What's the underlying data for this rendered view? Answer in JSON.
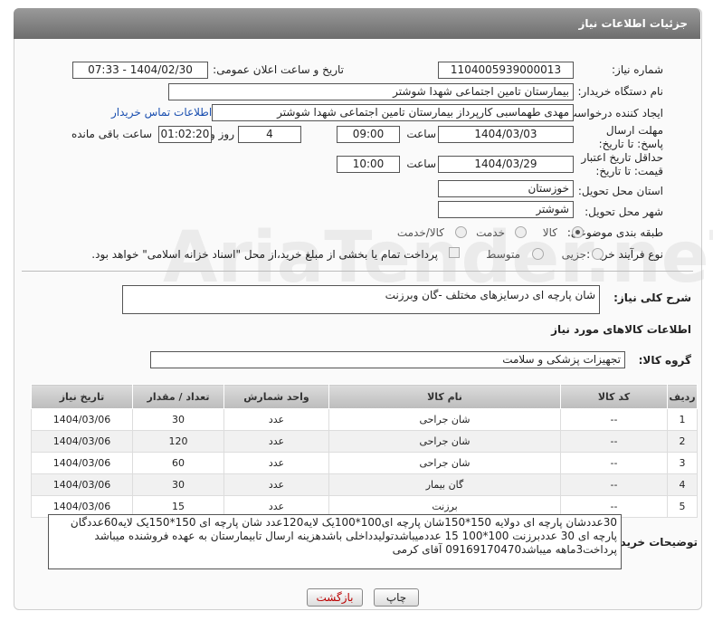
{
  "title": "جزئیات اطلاعات نیاز",
  "fields": {
    "need_number_label": "شماره نیاز:",
    "need_number": "1104005939000013",
    "announce_label": "تاریخ و ساعت اعلان عمومی:",
    "announce_value": "1404/02/30 - 07:33",
    "buyer_label": "نام دستگاه خریدار:",
    "buyer_value": "بیمارستان تامین اجتماعی شهدا شوشتر",
    "creator_label": "ایجاد کننده درخواست:",
    "creator_value": "مهدی طهماسبی کارپرداز بیمارستان تامین اجتماعی شهدا شوشتر",
    "contact_link": "اطلاعات تماس خریدار",
    "deadline_label": "مهلت ارسال پاسخ: تا تاریخ:",
    "deadline_date": "1404/03/03",
    "time_label": "ساعت",
    "deadline_time": "09:00",
    "days_value": "4",
    "days_label": "روز و",
    "remaining_value": "01:02:20",
    "remaining_label": "ساعت باقی مانده",
    "min_validity_label": "حداقل تاریخ اعتبار قیمت: تا تاریخ:",
    "validity_date": "1404/03/29",
    "validity_time": "10:00",
    "province_label": "استان محل تحویل:",
    "province_value": "خوزستان",
    "city_label": "شهر محل تحویل:",
    "city_value": "شوشتر",
    "category_label": "طبقه بندی موضوعی:",
    "category_options": [
      "کالا",
      "خدمت",
      "کالا/خدمت"
    ],
    "process_label": "نوع فرآیند خرید :",
    "process_options": [
      "جزیی",
      "متوسط"
    ],
    "payment_note": "پرداخت تمام یا بخشی از مبلغ خرید،از محل \"اسناد خزانه اسلامی\" خواهد بود.",
    "summary_label": "شرح کلی نیاز:",
    "summary_value": "شان پارچه ای درسایزهای مختلف -گان وبرزنت",
    "goods_info_title": "اطلاعات کالاهای مورد نیاز",
    "goods_group_label": "گروه کالا:",
    "goods_group_value": "تجهیزات پزشکی و سلامت"
  },
  "table": {
    "headers": [
      "ردیف",
      "کد کالا",
      "نام کالا",
      "واحد شمارش",
      "تعداد / مقدار",
      "تاریخ نیاز"
    ],
    "rows": [
      [
        "1",
        "--",
        "شان جراحی",
        "عدد",
        "30",
        "1404/03/06"
      ],
      [
        "2",
        "--",
        "شان جراحی",
        "عدد",
        "120",
        "1404/03/06"
      ],
      [
        "3",
        "--",
        "شان جراحی",
        "عدد",
        "60",
        "1404/03/06"
      ],
      [
        "4",
        "--",
        "گان بیمار",
        "عدد",
        "30",
        "1404/03/06"
      ],
      [
        "5",
        "--",
        "برزنت",
        "عدد",
        "15",
        "1404/03/06"
      ]
    ]
  },
  "buyer_notes_label": "توضیحات خریدار:",
  "buyer_notes": "30عددشان پارچه ای دولایه 150*150شان پارچه ای100*100یک لایه120عدد شان پارچه ای 150*150یک لایه60عددگان پارچه ای 30 عددبرزنت 100*100 15 عددمیباشدتولیدداخلی باشدهزینه ارسال تابیمارستان به عهده فروشنده میباشد پرداخت3ماهه میباشد09169170470 آقای کرمی",
  "buttons": {
    "print": "چاپ",
    "back": "بازگشت"
  },
  "watermark": "AriaTender.neT"
}
